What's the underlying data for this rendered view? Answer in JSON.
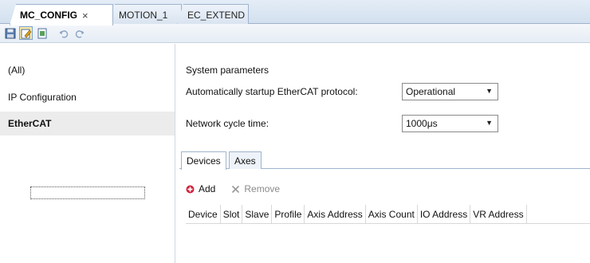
{
  "tabs": [
    {
      "label": "MC_CONFIG",
      "close": "×",
      "active": true
    },
    {
      "label": "MOTION_1",
      "active": false
    },
    {
      "label": "EC_EXTEND",
      "active": false
    }
  ],
  "toolbar": {
    "icons": [
      "save-icon",
      "edit-icon",
      "document-icon",
      "undo-icon",
      "redo-icon"
    ]
  },
  "nav": {
    "items": [
      {
        "label": "(All)",
        "selected": false
      },
      {
        "label": "IP Configuration",
        "selected": false
      },
      {
        "label": "EtherCAT",
        "selected": true
      }
    ]
  },
  "system": {
    "title": "System parameters",
    "auto_label": "Automatically startup EtherCAT protocol:",
    "auto_value": "Operational",
    "cycle_label": "Network cycle time:",
    "cycle_value": "1000μs"
  },
  "subtabs": [
    {
      "label": "Devices",
      "active": true
    },
    {
      "label": "Axes",
      "active": false
    }
  ],
  "actions": {
    "add": "Add",
    "remove": "Remove"
  },
  "grid": {
    "columns": [
      "Device",
      "Slot",
      "Slave",
      "Profile",
      "Axis Address",
      "Axis Count",
      "IO Address",
      "VR Address"
    ]
  },
  "colors": {
    "accent": "#9fb3cc",
    "add_icon": "#d0223c",
    "selected_bg": "#ececec"
  }
}
